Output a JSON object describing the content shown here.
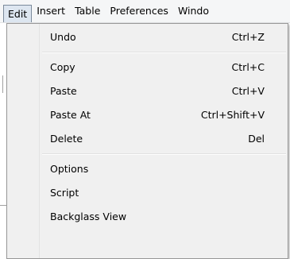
{
  "menubar": {
    "items": [
      {
        "label": "Edit"
      },
      {
        "label": "Insert"
      },
      {
        "label": "Table"
      },
      {
        "label": "Preferences"
      },
      {
        "label": "Windo"
      }
    ]
  },
  "edit_menu": {
    "undo": {
      "label": "Undo",
      "shortcut": "Ctrl+Z"
    },
    "copy": {
      "label": "Copy",
      "shortcut": "Ctrl+C"
    },
    "paste": {
      "label": "Paste",
      "shortcut": "Ctrl+V"
    },
    "paste_at": {
      "label": "Paste At",
      "shortcut": "Ctrl+Shift+V"
    },
    "delete": {
      "label": "Delete",
      "shortcut": "Del"
    },
    "options": {
      "label": "Options"
    },
    "script": {
      "label": "Script"
    },
    "backglass_view": {
      "label": "Backglass View"
    }
  }
}
